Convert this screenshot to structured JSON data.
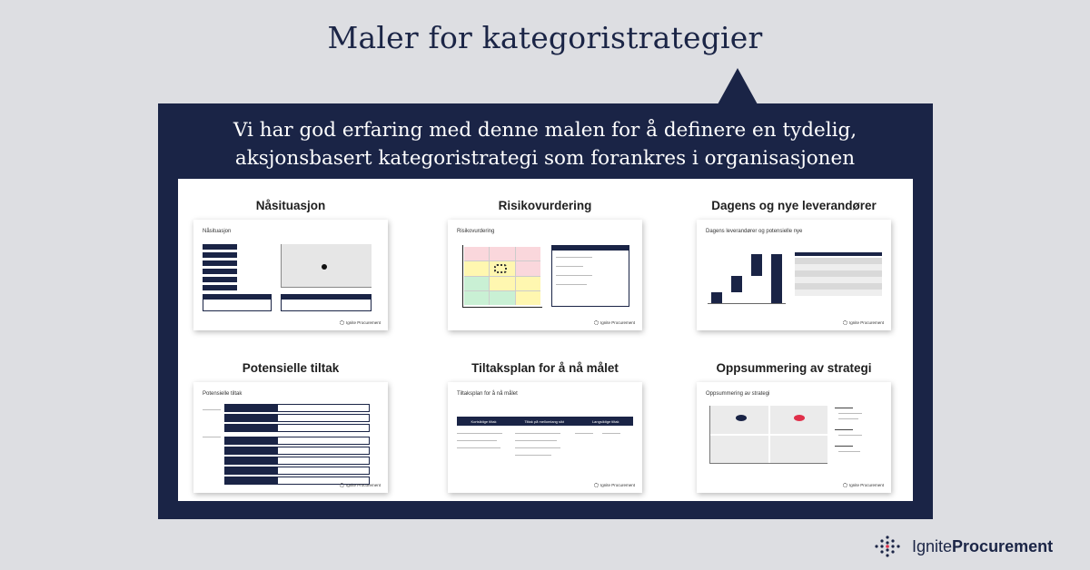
{
  "headline": "Maler for kategoristrategier",
  "subtitle": {
    "line1": "Vi har god erfaring med denne malen for å definere en tydelig,",
    "line2": "aksjonsbasert kategoristrategi som forankres i organisasjonen"
  },
  "cards": [
    {
      "title": "Nåsituasjon",
      "inner": "Nåsituasjon"
    },
    {
      "title": "Risikovurdering",
      "inner": "Risikovurdering"
    },
    {
      "title": "Dagens og nye leverandører",
      "inner": "Dagens leverandører og potensielle nye"
    },
    {
      "title": "Potensielle tiltak",
      "inner": "Potensielle tiltak"
    },
    {
      "title": "Tiltaksplan for å nå målet",
      "inner": "Tiltaksplan for å nå målet"
    },
    {
      "title": "Oppsummering av strategi",
      "inner": "Oppsummering av strategi"
    }
  ],
  "card_brand": "Ignite Procurement",
  "timeline": {
    "phase1": "Kortsiktige tiltak",
    "phase2": "Tiltak på mellomlang sikt",
    "phase3": "Langsiktige tiltak"
  },
  "brand": {
    "word1": "Ignite",
    "word2": "Procurement",
    "icon": "dot-grid-logo-icon"
  },
  "colors": {
    "navy": "#1a2446",
    "background": "#dddee2",
    "red_marker": "#e0304a"
  }
}
